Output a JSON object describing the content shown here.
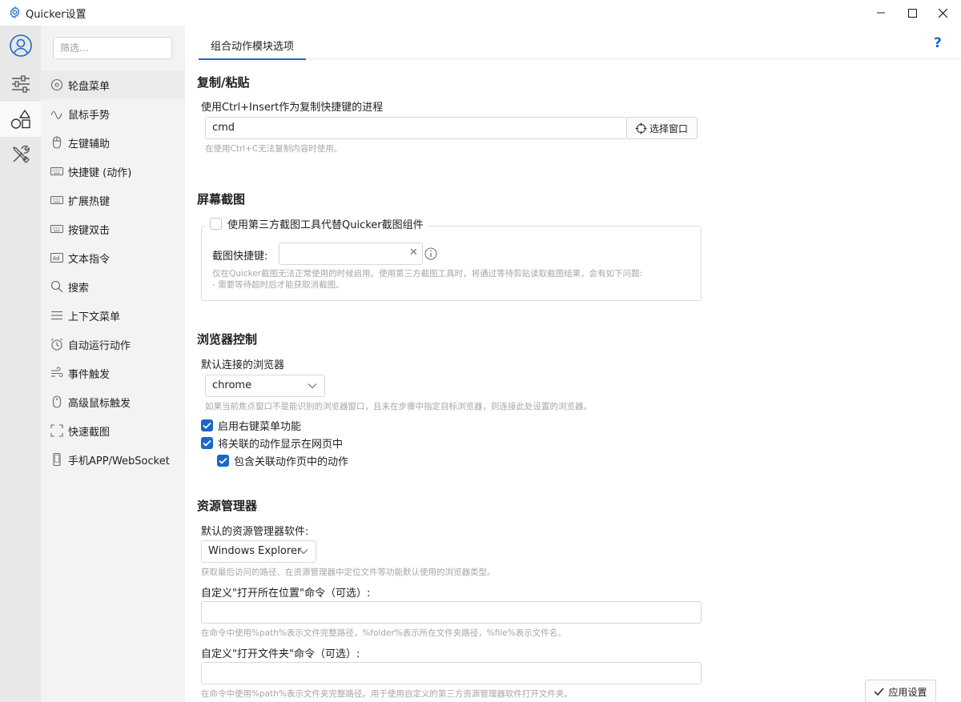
{
  "window": {
    "title": "Quicker设置",
    "controls": {
      "minimize": "minimize-icon",
      "maximize": "maximize-icon",
      "close": "close-icon"
    }
  },
  "iconbar": [
    {
      "icon": "user-icon",
      "active": false
    },
    {
      "icon": "sliders-icon",
      "active": false
    },
    {
      "icon": "shapes-icon",
      "active": true
    },
    {
      "icon": "tools-icon",
      "active": false
    }
  ],
  "sidebar": {
    "search_placeholder": "筛选...",
    "items": [
      {
        "label": "轮盘菜单",
        "icon": "wheel-icon"
      },
      {
        "label": "鼠标手势",
        "icon": "gesture-icon"
      },
      {
        "label": "左键辅助",
        "icon": "mouse-icon"
      },
      {
        "label": "快捷键 (动作)",
        "icon": "keyboard-icon"
      },
      {
        "label": "扩展热键",
        "icon": "keyboard-icon"
      },
      {
        "label": "按键双击",
        "icon": "keyboard-icon"
      },
      {
        "label": "文本指令",
        "icon": "text-ad-icon"
      },
      {
        "label": "搜索",
        "icon": "search-icon"
      },
      {
        "label": "上下文菜单",
        "icon": "menu-icon"
      },
      {
        "label": "自动运行动作",
        "icon": "alarm-icon"
      },
      {
        "label": "事件触发",
        "icon": "event-icon"
      },
      {
        "label": "高级鼠标触发",
        "icon": "mouse-icon"
      },
      {
        "label": "快速截图",
        "icon": "screenshot-icon"
      },
      {
        "label": "手机APP/WebSocket",
        "icon": "phone-icon"
      }
    ]
  },
  "tabs": [
    {
      "label": "组合动作模块选项",
      "active": true
    }
  ],
  "help_label": "?",
  "copy_paste": {
    "heading": "复制/粘贴",
    "label": "使用Ctrl+Insert作为复制快捷键的进程",
    "value": "cmd",
    "select_window_button": "选择窗口",
    "hint": "在使用Ctrl+C无法复制内容时使用。"
  },
  "screenshot": {
    "heading": "屏幕截图",
    "use_third_party_label": "使用第三方截图工具代替Quicker截图组件",
    "use_third_party_checked": false,
    "hotkey_label": "截图快捷键:",
    "hotkey_value": "",
    "clear_glyph": "✕",
    "hint_line1": "仅在Quicker截图无法正常使用的时候启用。使用第三方截图工具时，将通过等待剪贴读取截图结果，会有如下问题:",
    "hint_line2": "- 需要等待超时后才能获取消截图。"
  },
  "browser": {
    "heading": "浏览器控制",
    "default_label": "默认连接的浏览器",
    "default_value": "chrome",
    "hint": "如果当前焦点窗口不是能识别的浏览器窗口，且未在步骤中指定目标浏览器，则连接此处设置的浏览器。",
    "options": [
      {
        "label": "启用右键菜单功能",
        "checked": true
      },
      {
        "label": "将关联的动作显示在网页中",
        "checked": true
      },
      {
        "label": "包含关联动作页中的动作",
        "checked": true
      }
    ]
  },
  "explorer": {
    "heading": "资源管理器",
    "default_label": "默认的资源管理器软件:",
    "default_value": "Windows Explorer",
    "default_hint": "获取最后访问的路径、在资源管理器中定位文件等功能默认使用的浏览器类型。",
    "open_location_label": "自定义\"打开所在位置\"命令（可选）:",
    "open_location_value": "",
    "open_location_hint": "在命令中使用%path%表示文件完整路径，%folder%表示所在文件夹路径，%file%表示文件名。",
    "open_folder_label": "自定义\"打开文件夹\"命令（可选）:",
    "open_folder_value": "",
    "open_folder_hint": "在命令中使用%path%表示文件夹完整路径。用于使用自定义的第三方资源管理器软件打开文件夹。"
  },
  "apply_button": "应用设置",
  "colors": {
    "accent": "#1a67c8",
    "sidebar_bg": "#f3f3f3",
    "iconbar_bg": "#e8e8e8"
  }
}
